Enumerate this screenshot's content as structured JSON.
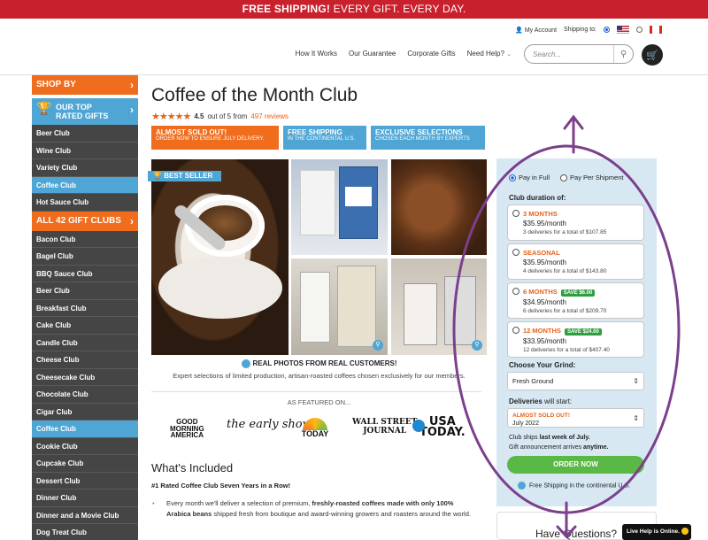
{
  "banner": {
    "bold": "FREE SHIPPING!",
    "rest": "EVERY GIFT. EVERY DAY."
  },
  "utility": {
    "account": "My Account",
    "shipping_to": "Shipping to:"
  },
  "nav": {
    "items": [
      "How It Works",
      "Our Guarantee",
      "Corporate Gifts",
      "Need Help?"
    ],
    "chevron": "⌄"
  },
  "search": {
    "placeholder": "Search...",
    "icon": "search-icon"
  },
  "cart": {
    "icon": "cart-icon"
  },
  "sidebar": {
    "shop_by": "SHOP BY",
    "top_rated_line1": "OUR TOP",
    "top_rated_line2": "RATED GIFTS",
    "top_items": [
      "Beer Club",
      "Wine Club",
      "Variety Club",
      "Coffee Club",
      "Hot Sauce Club"
    ],
    "all_clubs": "ALL 42 GIFT CLUBS",
    "all_items": [
      "Bacon Club",
      "Bagel Club",
      "BBQ Sauce Club",
      "Beer Club",
      "Breakfast Club",
      "Cake Club",
      "Candle Club",
      "Cheese Club",
      "Cheesecake Club",
      "Chocolate Club",
      "Cigar Club",
      "Coffee Club",
      "Cookie Club",
      "Cupcake Club",
      "Dessert Club",
      "Dinner Club",
      "Dinner and a Movie Club",
      "Dog Treat Club"
    ]
  },
  "product": {
    "title": "Coffee of the Month Club",
    "stars": "★★★★★",
    "rating": "4.5",
    "rating_suffix": "out of 5 from",
    "reviews": "497 reviews"
  },
  "badges": [
    {
      "title": "ALMOST SOLD OUT!",
      "sub": "ORDER NOW TO ENSURE JULY DELIVERY."
    },
    {
      "title": "FREE SHIPPING",
      "sub": "IN THE CONTINENTAL U.S."
    },
    {
      "title": "EXCLUSIVE SELECTIONS",
      "sub": "CHOSEN EACH MONTH BY EXPERTS"
    }
  ],
  "gallery": {
    "best_seller": "BEST SELLER"
  },
  "real_photos": {
    "title": "REAL PHOTOS FROM REAL CUSTOMERS!",
    "sub": "Expert selections of limited production, artisan-roasted coffees chosen exclusively for our members."
  },
  "featured": {
    "label": "AS FEATURED ON...",
    "logos": {
      "gma1": "GOOD",
      "gma2": "MORNING",
      "gma3": "AMERICA",
      "early": "the early show",
      "today": "TODAY",
      "wsj1": "WALL STREET",
      "wsj2": "JOURNAL",
      "usa1": "USA",
      "usa2": "TODAY."
    }
  },
  "included": {
    "title": "What's Included",
    "sub": "#1 Rated Coffee Club Seven Years in a Row!",
    "bullet_a": "Every month we'll deliver a selection of premium, ",
    "bullet_b": "freshly-roasted coffees made with only 100% Arabica beans",
    "bullet_c": " shipped fresh from boutique and award-winning growers and roasters around the world."
  },
  "panel": {
    "pay_full": "Pay in Full",
    "pay_per": "Pay Per Shipment",
    "duration_label": "Club duration of:",
    "options": [
      {
        "name": "3 MONTHS",
        "save": "",
        "price": "$35.95/month",
        "detail": "3 deliveries for a total of $107.85"
      },
      {
        "name": "SEASONAL",
        "save": "",
        "price": "$35.95/month",
        "detail": "4 deliveries for a total of $143.80"
      },
      {
        "name": "6 MONTHS",
        "save": "SAVE $6.00",
        "price": "$34.95/month",
        "detail": "6 deliveries for a total of $209.70"
      },
      {
        "name": "12 MONTHS",
        "save": "SAVE $24.00",
        "price": "$33.95/month",
        "detail": "12 deliveries for a total of $407.40"
      }
    ],
    "grind_label": "Choose Your Grind:",
    "grind_value": "Fresh Ground",
    "deliveries_label_bold": "Deliveries",
    "deliveries_label_rest": " will start:",
    "deliveries_flag": "ALMOST SOLD OUT!",
    "deliveries_value": "July 2022",
    "ships_a": "Club ships ",
    "ships_b": "last week of July.",
    "gift_a": "Gift announcement arrives ",
    "gift_b": "anytime.",
    "order": "ORDER NOW",
    "free_ship": "Free Shipping in the continental U.S."
  },
  "have_questions": "Have Questions?",
  "live_help": "Live Help is Online.",
  "colors": {
    "brand_red": "#c8202c",
    "orange": "#ef6d1c",
    "blue": "#4fa6d4",
    "green": "#5ab847",
    "annotation_purple": "#7b3f8c"
  }
}
